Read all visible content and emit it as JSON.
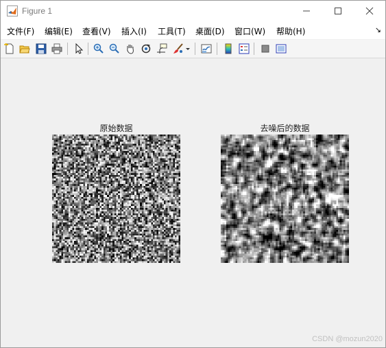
{
  "window": {
    "title": "Figure 1"
  },
  "menu": [
    "文件(F)",
    "编辑(E)",
    "查看(V)",
    "插入(I)",
    "工具(T)",
    "桌面(D)",
    "窗口(W)",
    "帮助(H)"
  ],
  "toolbar_icons": [
    "new-figure-icon",
    "open-file-icon",
    "save-icon",
    "print-icon",
    "select-pointer-icon",
    "zoom-in-icon",
    "zoom-out-icon",
    "pan-hand-icon",
    "rotate-3d-icon",
    "data-cursor-icon",
    "brush-icon",
    "brush-dropdown-icon",
    "link-plot-icon",
    "colorbar-icon",
    "legend-icon",
    "hide-plot-tools-icon",
    "show-plot-tools-icon"
  ],
  "plots": {
    "left_title": "原始数据",
    "right_title": "去噪后的数据"
  },
  "watermark": "CSDN @mozun2020"
}
